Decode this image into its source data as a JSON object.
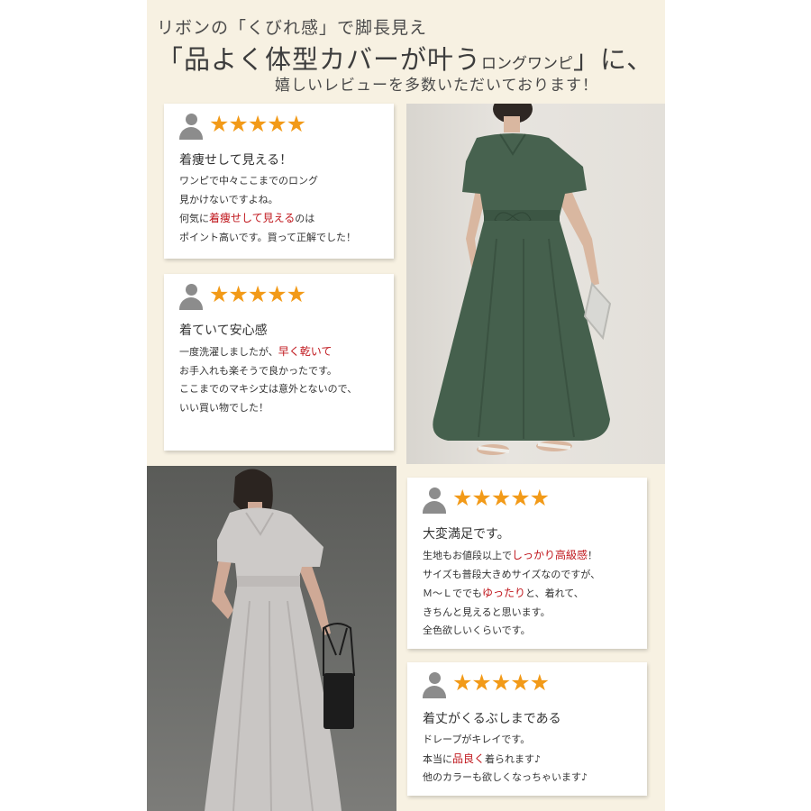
{
  "header": {
    "line1": "リボンの「くびれ感」で脚長見え",
    "line2_big": "「品よく体型カバーが叶う",
    "line2_small": "ロングワンピ",
    "line2_end": "」に、",
    "line3": "嬉しいレビューを多数いただいております！"
  },
  "reviews": [
    {
      "stars": "★★★★★",
      "title": "着痩せして見える！",
      "lines": [
        {
          "a": "ワンピで中々ここまでのロング"
        },
        {
          "a": "見かけないですよね。"
        },
        {
          "a": "何気に",
          "hl": "着痩せして見える",
          "b": "のは"
        },
        {
          "a": "ポイント高いです。買って正解でした！"
        }
      ]
    },
    {
      "stars": "★★★★★",
      "title": "着ていて安心感",
      "lines": [
        {
          "a": "一度洗濯しましたが、",
          "hl": "早く乾いて"
        },
        {
          "a": "お手入れも楽そうで良かったです。"
        },
        {
          "a": "ここまでのマキシ丈は意外とないので、"
        },
        {
          "a": "いい買い物でした！"
        }
      ]
    },
    {
      "stars": "★★★★★",
      "title": "大変満足です。",
      "lines": [
        {
          "a": "生地もお値段以上で",
          "hl": "しっかり高級感",
          "b": "！"
        },
        {
          "a": "サイズも普段大きめサイズなのですが、"
        },
        {
          "a": "Ｍ～Ｌででも",
          "hl": "ゆったり",
          "b": "と、着れて、"
        },
        {
          "a": "きちんと見えると思います。"
        },
        {
          "a": "全色欲しいくらいです。"
        }
      ]
    },
    {
      "stars": "★★★★★",
      "title": "着丈がくるぶしまである",
      "lines": [
        {
          "a": "ドレープがキレイです。"
        },
        {
          "a": "本当に",
          "hl": "品良く",
          "b": "着られます♪"
        },
        {
          "a": "他のカラーも欲しくなっちゃいます♪"
        }
      ]
    }
  ],
  "colors": {
    "panel_bg": "#f7f1e2",
    "star": "#f29a18",
    "highlight": "#c0171d",
    "dress_green": "#45604d",
    "dress_gray": "#c9c6c4"
  }
}
